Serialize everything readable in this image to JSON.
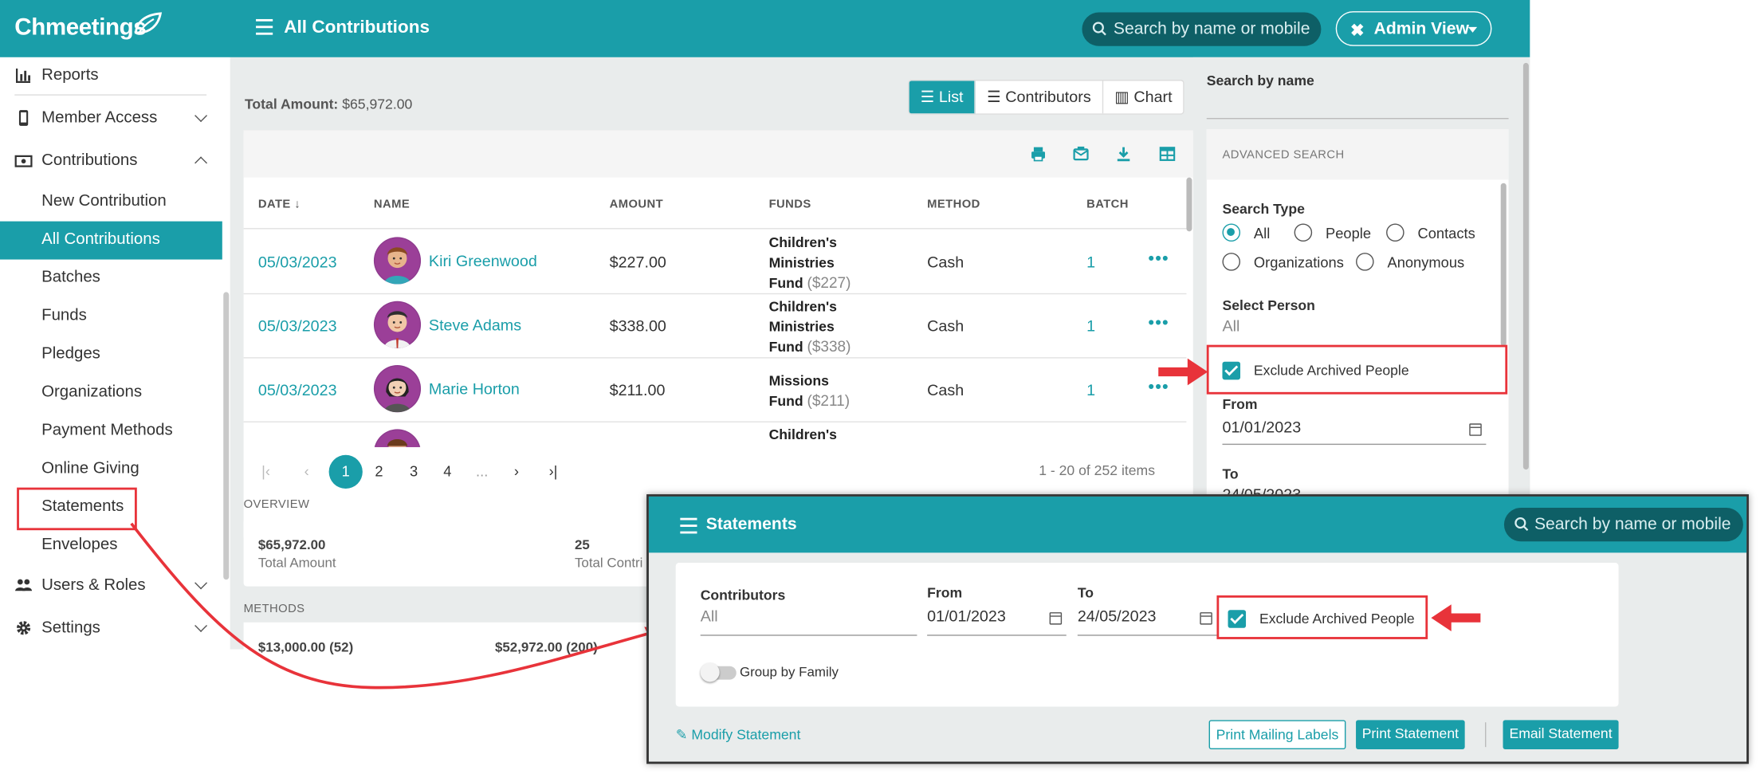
{
  "app": {
    "logo": "Chmeetings"
  },
  "header": {
    "title": "All Contributions",
    "search_placeholder": "Search by name or mobile",
    "view_button": "Admin View"
  },
  "sidebar": {
    "items": [
      {
        "label": "Reports"
      },
      {
        "label": "Member Access"
      },
      {
        "label": "Contributions"
      },
      {
        "label": "New Contribution"
      },
      {
        "label": "All Contributions"
      },
      {
        "label": "Batches"
      },
      {
        "label": "Funds"
      },
      {
        "label": "Pledges"
      },
      {
        "label": "Organizations"
      },
      {
        "label": "Payment Methods"
      },
      {
        "label": "Online Giving"
      },
      {
        "label": "Statements"
      },
      {
        "label": "Envelopes"
      },
      {
        "label": "Users & Roles"
      },
      {
        "label": "Settings"
      }
    ]
  },
  "main": {
    "total_label": "Total Amount:",
    "total_value": "$65,972.00",
    "views": [
      "List",
      "Contributors",
      "Chart"
    ],
    "columns": [
      "DATE",
      "NAME",
      "AMOUNT",
      "FUNDS",
      "METHOD",
      "BATCH"
    ],
    "rows": [
      {
        "date": "05/03/2023",
        "name": "Kiri Greenwood",
        "amount": "$227.00",
        "fund_l1": "Children's",
        "fund_l2": "Ministries",
        "fund_l3": "Fund",
        "fund_amt": "($227)",
        "method": "Cash",
        "batch": "1"
      },
      {
        "date": "05/03/2023",
        "name": "Steve Adams",
        "amount": "$338.00",
        "fund_l1": "Children's",
        "fund_l2": "Ministries",
        "fund_l3": "Fund",
        "fund_amt": "($338)",
        "method": "Cash",
        "batch": "1"
      },
      {
        "date": "05/03/2023",
        "name": "Marie Horton",
        "amount": "$211.00",
        "fund_l1": "Missions",
        "fund_l2": "",
        "fund_l3": "Fund",
        "fund_amt": "($211)",
        "method": "Cash",
        "batch": "1"
      },
      {
        "date": "",
        "name": "",
        "amount": "",
        "fund_l1": "Children's",
        "fund_l2": "",
        "fund_l3": "",
        "fund_amt": "",
        "method": "",
        "batch": ""
      }
    ],
    "pager": {
      "pages": [
        "1",
        "2",
        "3",
        "4",
        "..."
      ],
      "info": "1 - 20 of 252 items"
    },
    "overview": {
      "label": "OVERVIEW",
      "total_amount_value": "$65,972.00",
      "total_amount_label": "Total Amount",
      "total_contrib_value": "25",
      "total_contrib_label": "Total Contri"
    },
    "methods": {
      "label": "METHODS",
      "v1": "$13,000.00 (52)",
      "v2": "$52,972.00 (200)"
    }
  },
  "right_panel": {
    "search_by_name": "Search by name",
    "advanced_search": "ADVANCED SEARCH",
    "search_type_label": "Search Type",
    "search_types": [
      "All",
      "People",
      "Contacts",
      "Organizations",
      "Anonymous"
    ],
    "select_person_label": "Select Person",
    "select_person_value": "All",
    "exclude_archived": "Exclude Archived People",
    "from_label": "From",
    "from_value": "01/01/2023",
    "to_label": "To",
    "to_value": "24/05/2023"
  },
  "statements": {
    "title": "Statements",
    "search_placeholder": "Search by name or mobile",
    "contributors_label": "Contributors",
    "contributors_value": "All",
    "from_label": "From",
    "from_value": "01/01/2023",
    "to_label": "To",
    "to_value": "24/05/2023",
    "exclude_archived": "Exclude Archived People",
    "group_by_family": "Group by Family",
    "modify": "Modify Statement",
    "print_labels": "Print Mailing Labels",
    "print_statement": "Print Statement",
    "email_statement": "Email Statement"
  },
  "colors": {
    "accent": "#1a9ea9",
    "highlight": "#e8333a"
  }
}
